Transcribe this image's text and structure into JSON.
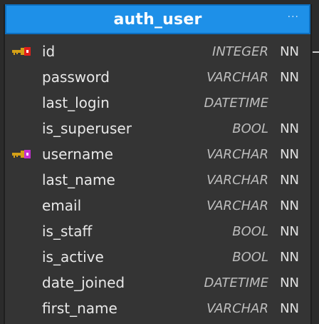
{
  "table": {
    "name": "auth_user",
    "menu_label": "···",
    "columns": [
      {
        "name": "id",
        "type": "INTEGER",
        "null": "NN",
        "key": "primary"
      },
      {
        "name": "password",
        "type": "VARCHAR",
        "null": "NN",
        "key": ""
      },
      {
        "name": "last_login",
        "type": "DATETIME",
        "null": "",
        "key": ""
      },
      {
        "name": "is_superuser",
        "type": "BOOL",
        "null": "NN",
        "key": ""
      },
      {
        "name": "username",
        "type": "VARCHAR",
        "null": "NN",
        "key": "unique"
      },
      {
        "name": "last_name",
        "type": "VARCHAR",
        "null": "NN",
        "key": ""
      },
      {
        "name": "email",
        "type": "VARCHAR",
        "null": "NN",
        "key": ""
      },
      {
        "name": "is_staff",
        "type": "BOOL",
        "null": "NN",
        "key": ""
      },
      {
        "name": "is_active",
        "type": "BOOL",
        "null": "NN",
        "key": ""
      },
      {
        "name": "date_joined",
        "type": "DATETIME",
        "null": "NN",
        "key": ""
      },
      {
        "name": "first_name",
        "type": "VARCHAR",
        "null": "NN",
        "key": ""
      }
    ]
  },
  "icons": {
    "primary": "primary-key-icon",
    "unique": "unique-key-icon"
  },
  "colors": {
    "header_bg": "#1e90e8",
    "header_border": "#0d6fbf",
    "body_bg": "#343434",
    "canvas_bg": "#2b2b2b",
    "key_gold": "#d4a017",
    "primary_key_tag": "#e0201b",
    "unique_key_tag": "#c42fd1"
  }
}
